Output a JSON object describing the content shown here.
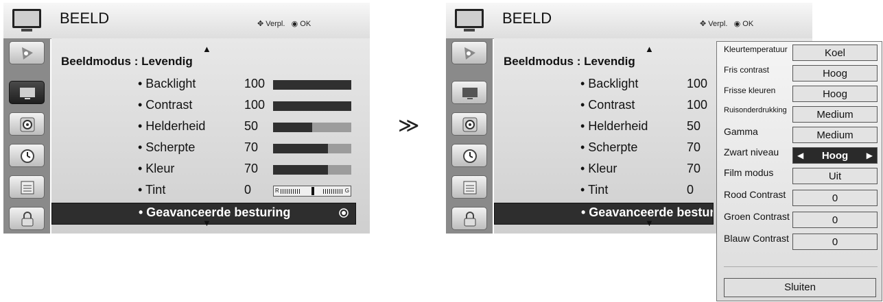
{
  "left": {
    "title": "BEELD",
    "nav_hint": "Verpl.",
    "ok_hint": "OK",
    "mode_label": "Beeldmodus : Levendig",
    "rows": [
      {
        "label": "• Backlight",
        "value": "100",
        "level": 1.0
      },
      {
        "label": "• Contrast",
        "value": "100",
        "level": 1.0
      },
      {
        "label": "• Helderheid",
        "value": "50",
        "level": 0.5
      },
      {
        "label": "• Scherpte",
        "value": "70",
        "level": 0.7
      },
      {
        "label": "• Kleur",
        "value": "70",
        "level": 0.7
      }
    ],
    "tint": {
      "label": "• Tint",
      "value": "0",
      "left_letter": "R",
      "right_letter": "G"
    },
    "selected": "• Geavanceerde besturing"
  },
  "right": {
    "title": "BEELD",
    "nav_hint": "Verpl.",
    "ok_hint": "OK",
    "mode_label": "Beeldmodus : Levendig",
    "rows": [
      {
        "label": "• Backlight",
        "value": "100"
      },
      {
        "label": "• Contrast",
        "value": "100"
      },
      {
        "label": "• Helderheid",
        "value": "50"
      },
      {
        "label": "• Scherpte",
        "value": "70"
      },
      {
        "label": "• Kleur",
        "value": "70"
      },
      {
        "label": "• Tint",
        "value": "0"
      }
    ],
    "selected": "• Geavanceerde besturing"
  },
  "separator": "≫",
  "popup": {
    "items": [
      {
        "label": "Kleurtemperatuur",
        "value": "Koel"
      },
      {
        "label": "Fris contrast",
        "value": "Hoog"
      },
      {
        "label": "Frisse kleuren",
        "value": "Hoog"
      },
      {
        "label": "Ruisonderdrukking",
        "value": "Medium"
      },
      {
        "label": "Gamma",
        "value": "Medium"
      },
      {
        "label": "Zwart niveau",
        "value": "Hoog"
      },
      {
        "label": "Film modus",
        "value": "Uit"
      },
      {
        "label": "Rood Contrast",
        "value": "0"
      },
      {
        "label": "Groen Contrast",
        "value": "0"
      },
      {
        "label": "Blauw Contrast",
        "value": "0"
      }
    ],
    "close_label": "Sluiten"
  },
  "colors": {
    "bar_fill": "#303030",
    "bar_bg": "#9c9c9c",
    "sidebar": "#8a8a8a",
    "selected_row": "#2e2e2e"
  },
  "icons": [
    "tv-icon",
    "antenna-icon",
    "picture-icon",
    "speaker-icon",
    "clock-icon",
    "options-icon",
    "lock-icon"
  ]
}
